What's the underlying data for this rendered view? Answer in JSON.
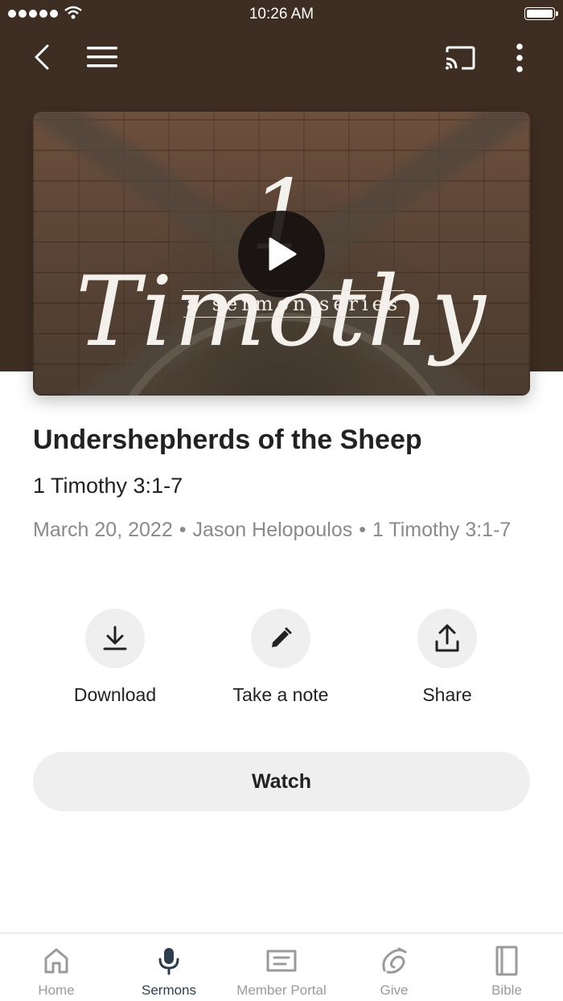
{
  "status_bar": {
    "time": "10:26 AM"
  },
  "header": {
    "back_icon": "chevron-left-icon",
    "menu_icon": "hamburger-menu-icon",
    "cast_icon": "cast-icon",
    "more_icon": "more-vertical-icon"
  },
  "hero": {
    "series_title": "1 Timothy",
    "series_subtitle": "a sermon series",
    "play_icon": "play-icon"
  },
  "sermon": {
    "title": "Undershepherds of the Sheep",
    "passage": "1 Timothy 3:1-7",
    "date": "March 20, 2022",
    "separator": "•",
    "speaker": "Jason Helopoulos",
    "series_passage": "1 Timothy 3:1-7"
  },
  "actions": [
    {
      "label": "Download",
      "icon": "download-icon"
    },
    {
      "label": "Take a note",
      "icon": "pencil-icon"
    },
    {
      "label": "Share",
      "icon": "share-icon"
    }
  ],
  "watch_button": {
    "label": "Watch"
  },
  "tabbar": {
    "active": "Sermons",
    "active_color": "#2f3e4e",
    "inactive_color": "#9a9a9a",
    "items": [
      {
        "label": "Home",
        "icon": "home-icon"
      },
      {
        "label": "Sermons",
        "icon": "microphone-icon"
      },
      {
        "label": "Member Portal",
        "icon": "portal-icon"
      },
      {
        "label": "Give",
        "icon": "give-icon"
      },
      {
        "label": "Bible",
        "icon": "book-icon"
      }
    ]
  },
  "colors": {
    "header_background": "#3e2d22",
    "button_background": "#efefef"
  }
}
